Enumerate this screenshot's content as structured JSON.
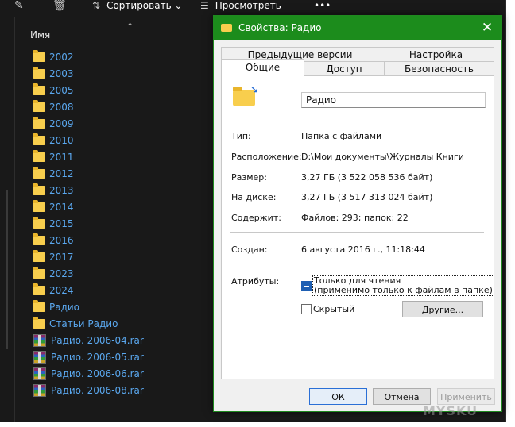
{
  "explorer": {
    "toolbar": {
      "sort_label": "Сортировать",
      "view_label": "Просмотреть",
      "more_label": "•••"
    },
    "column_header": "Имя",
    "items": [
      {
        "name": "2002",
        "type": "folder"
      },
      {
        "name": "2003",
        "type": "folder"
      },
      {
        "name": "2005",
        "type": "folder"
      },
      {
        "name": "2008",
        "type": "folder"
      },
      {
        "name": "2009",
        "type": "folder"
      },
      {
        "name": "2010",
        "type": "folder"
      },
      {
        "name": "2011",
        "type": "folder"
      },
      {
        "name": "2012",
        "type": "folder"
      },
      {
        "name": "2013",
        "type": "folder"
      },
      {
        "name": "2014",
        "type": "folder"
      },
      {
        "name": "2015",
        "type": "folder"
      },
      {
        "name": "2016",
        "type": "folder"
      },
      {
        "name": "2017",
        "type": "folder"
      },
      {
        "name": "2023",
        "type": "folder"
      },
      {
        "name": "2024",
        "type": "folder"
      },
      {
        "name": "Радио",
        "type": "folder"
      },
      {
        "name": "Статьи Радио",
        "type": "folder"
      },
      {
        "name": "Радио. 2006-04.rar",
        "type": "rar"
      },
      {
        "name": "Радио. 2006-05.rar",
        "type": "rar"
      },
      {
        "name": "Радио. 2006-06.rar",
        "type": "rar"
      },
      {
        "name": "Радио. 2006-08.rar",
        "type": "rar"
      }
    ]
  },
  "dialog": {
    "title": "Свойства: Радио",
    "tabs_row1": [
      "Предыдущие версии",
      "Настройка"
    ],
    "tabs_row2": [
      "Общие",
      "Доступ",
      "Безопасность"
    ],
    "active_tab": "Общие",
    "folder_name": "Радио",
    "properties": {
      "type_label": "Тип:",
      "type_value": "Папка с файлами",
      "location_label": "Расположение:",
      "location_value": "D:\\Мои документы\\Журналы Книги",
      "size_label": "Размер:",
      "size_value": "3,27 ГБ (3 522 058 536 байт)",
      "disk_label": "На диске:",
      "disk_value": "3,27 ГБ (3 517 313 024 байт)",
      "contains_label": "Содержит:",
      "contains_value": "Файлов: 293; папок: 22",
      "created_label": "Создан:",
      "created_value": "6 августа 2016 г., 11:18:44",
      "attributes_label": "Атрибуты:"
    },
    "attributes": {
      "readonly_line1": "Только для чтения",
      "readonly_line2": "(применимо только к файлам в папке)",
      "readonly_state": "indeterminate",
      "hidden_label": "Скрытый",
      "hidden_checked": false,
      "other_button": "Другие..."
    },
    "buttons": {
      "ok": "ОК",
      "cancel": "Отмена",
      "apply": "Применить"
    },
    "accent_color": "#1c8c1c"
  },
  "watermark": "MYSKU"
}
